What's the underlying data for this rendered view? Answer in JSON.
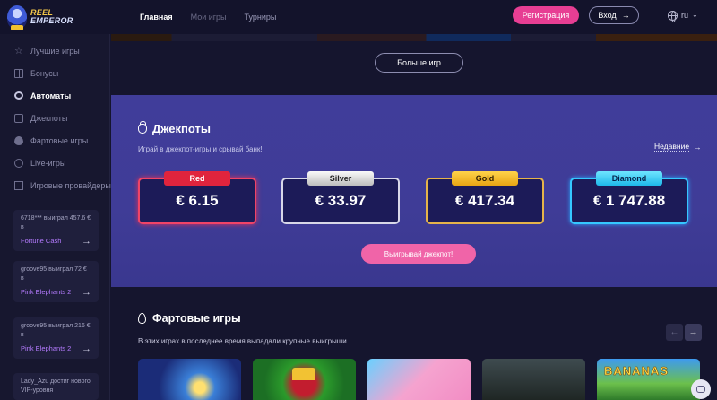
{
  "logo": {
    "line1": "REEL",
    "line2": "EMPEROR"
  },
  "nav": {
    "home": "Главная",
    "my_games": "Мои игры",
    "tournaments": "Турниры"
  },
  "header": {
    "register": "Регистрация",
    "login": "Вход",
    "login_arrow": "→",
    "lang": "ru",
    "lang_chevron": "⌄"
  },
  "sidebar": {
    "items": [
      {
        "label": "Лучшие игры",
        "icon": "star-icon"
      },
      {
        "label": "Бонусы",
        "icon": "gift-icon"
      },
      {
        "label": "Автоматы",
        "icon": "slots-icon",
        "active": true
      },
      {
        "label": "Джекпоты",
        "icon": "jackpot-icon"
      },
      {
        "label": "Фартовые игры",
        "icon": "fire-icon"
      },
      {
        "label": "Live-игры",
        "icon": "live-icon"
      },
      {
        "label": "Игровые провайдеры",
        "icon": "providers-icon"
      }
    ],
    "wins": [
      {
        "text": "6718*** выиграл 457.6 € в",
        "game": "Fortune Cash"
      },
      {
        "text": "groove95 выиграл 72 € в",
        "game": "Pink Elephants 2"
      },
      {
        "text": "groove95 выиграл 216 € в",
        "game": "Pink Elephants 2"
      },
      {
        "text": "Lady_Azu достиг нового VIP-уровня",
        "game": ""
      }
    ]
  },
  "main": {
    "more_games": "Больше игр",
    "jackpots": {
      "title": "Джекпоты",
      "subtitle": "Играй в джекпот-игры и срывай банк!",
      "recent": "Недавние",
      "recent_arrow": "→",
      "cards": [
        {
          "label": "Red",
          "value": "€ 6.15"
        },
        {
          "label": "Silver",
          "value": "€ 33.97"
        },
        {
          "label": "Gold",
          "value": "€ 417.34"
        },
        {
          "label": "Diamond",
          "value": "€ 1 747.88"
        }
      ],
      "win_button": "Выигрывай джекпот!"
    },
    "hot_games": {
      "title": "Фартовые игры",
      "subtitle": "В этих играх в последнее время выпадали крупные выигрыши",
      "prev": "←",
      "next": "→",
      "thumb_text": "BANANAS"
    }
  },
  "colors": {
    "accent_pink": "#e73e93",
    "jackpot_bg": "#403d9a",
    "red": "#e0243d",
    "gold": "#f2b320",
    "diamond": "#2fc2f2"
  }
}
